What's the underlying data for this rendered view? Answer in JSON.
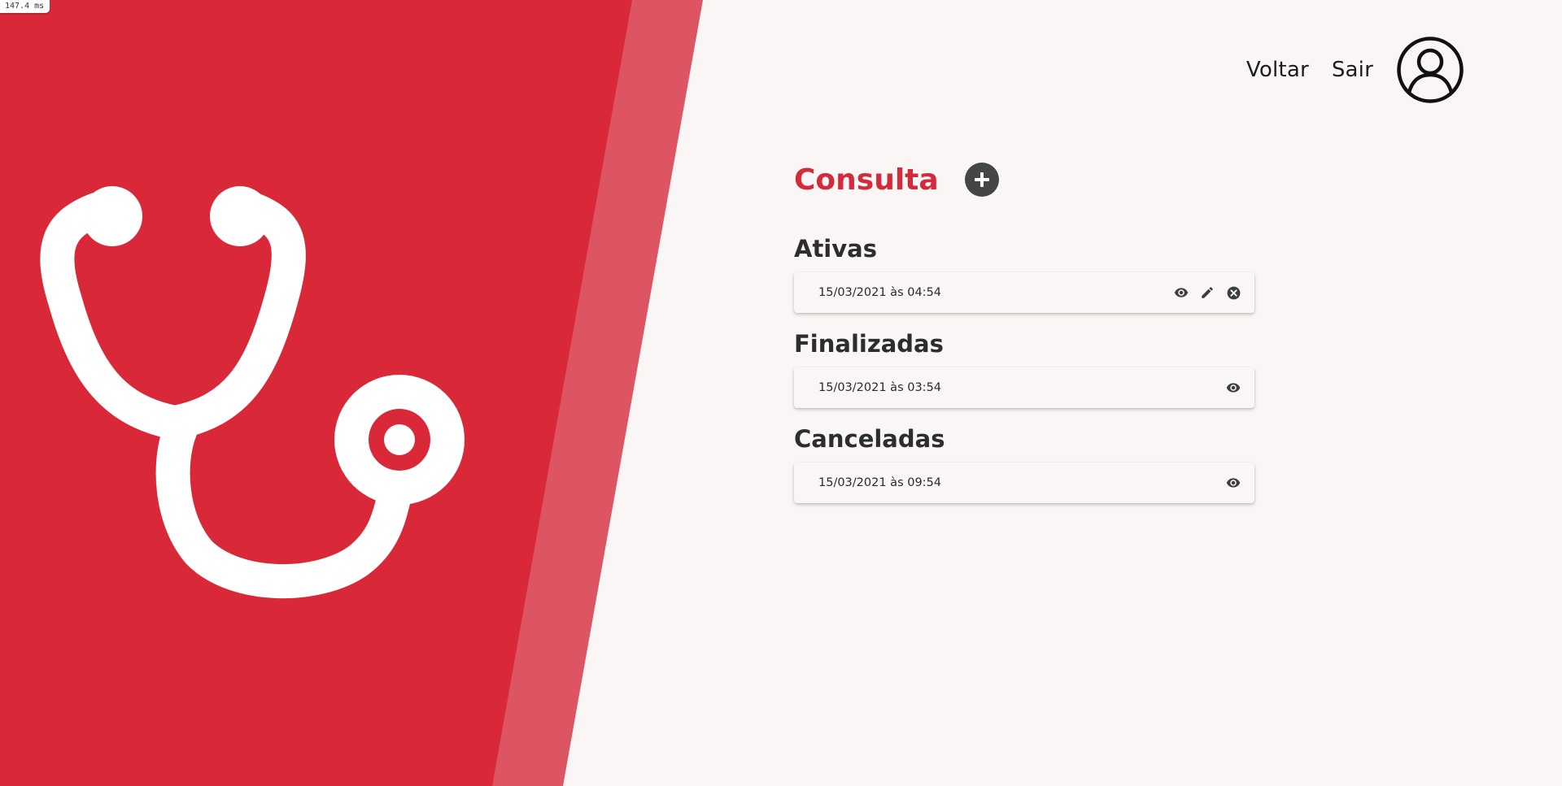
{
  "perf_badge": "147.4 ms",
  "colors": {
    "brand_red": "#d92938",
    "stripe": "#dd5462",
    "page_bg": "#faf6f5",
    "title_red": "#d32a3c",
    "dark": "#434547"
  },
  "header": {
    "nav": [
      {
        "label": "Voltar"
      },
      {
        "label": "Sair"
      }
    ],
    "avatar_icon": "user-circle-icon"
  },
  "main": {
    "title": "Consulta",
    "add_icon": "plus-circle-icon",
    "sections": [
      {
        "title": "Ativas",
        "items": [
          {
            "date": "15/03/2021 às 04:54",
            "actions": [
              "eye-icon",
              "pencil-icon",
              "close-circle-icon"
            ]
          }
        ]
      },
      {
        "title": "Finalizadas",
        "items": [
          {
            "date": "15/03/2021 às 03:54",
            "actions": [
              "eye-icon"
            ]
          }
        ]
      },
      {
        "title": "Canceladas",
        "items": [
          {
            "date": "15/03/2021 às 09:54",
            "actions": [
              "eye-icon"
            ]
          }
        ]
      }
    ]
  },
  "illustration_icon": "stethoscope-icon"
}
